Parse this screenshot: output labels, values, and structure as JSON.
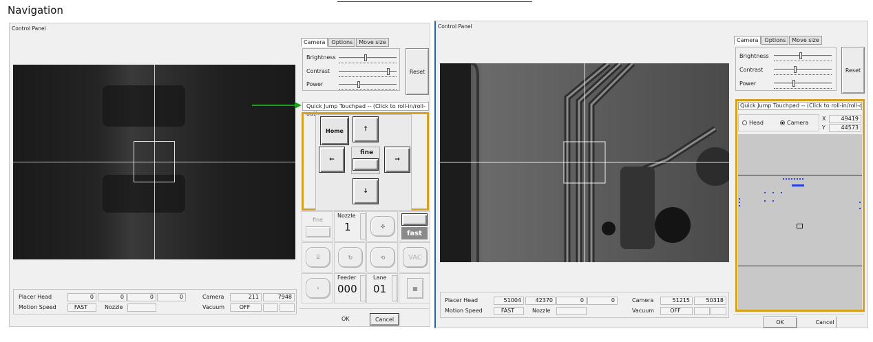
{
  "page_title": "Navigation",
  "left_panel": {
    "window_title": "Control Panel",
    "tabs": [
      "Camera",
      "Options",
      "Move size"
    ],
    "sliders": [
      {
        "label": "Brightness",
        "value": 0.45
      },
      {
        "label": "Contrast",
        "value": 0.88
      },
      {
        "label": "Power",
        "value": 0.33
      }
    ],
    "reset_label": "Reset",
    "touchpad_header": "Quick Jump Touchpad -- (Click to roll-in/roll-out)",
    "jog": {
      "home": "Home",
      "up": "↑",
      "left": "←",
      "fine": "fine",
      "right": "→",
      "down": "↓"
    },
    "controls": {
      "fine_label": "fine",
      "nozzle_label": "Nozzle",
      "nozzle_value": "1",
      "fast_label": "fast",
      "vac_label": "VAC",
      "feeder_label": "Feeder",
      "feeder_value": "000",
      "lane_label": "Lane",
      "lane_value": "01"
    },
    "info": {
      "placer_head_label": "Placer Head",
      "placer_head_values": [
        "0",
        "0",
        "0",
        "0"
      ],
      "camera_label": "Camera",
      "camera_values": [
        "211",
        "7948"
      ],
      "motion_speed_label": "Motion Speed",
      "motion_speed_value": "FAST",
      "nozzle_label": "Nozzle",
      "vacuum_label": "Vacuum",
      "vacuum_value": "OFF"
    },
    "ok_label": "OK",
    "cancel_label": "Cancel"
  },
  "right_panel": {
    "window_title": "Control Panel",
    "tabs": [
      "Camera",
      "Options",
      "Move size"
    ],
    "sliders": [
      {
        "label": "Brightness",
        "value": 0.45
      },
      {
        "label": "Contrast",
        "value": 0.35
      },
      {
        "label": "Power",
        "value": 0.33
      }
    ],
    "reset_label": "Reset",
    "touchpad_header": "Quick Jump Touchpad -- (Click to roll-in/roll-out)",
    "radio_head_label": "Head",
    "radio_camera_label": "Camera",
    "selected_radio": "Camera",
    "x_label": "X",
    "x_value": "49419",
    "y_label": "Y",
    "y_value": "44573",
    "info": {
      "placer_head_label": "Placer Head",
      "placer_head_values": [
        "51004",
        "42370",
        "0",
        "0"
      ],
      "camera_label": "Camera",
      "camera_values": [
        "51215",
        "50318"
      ],
      "motion_speed_label": "Motion Speed",
      "motion_speed_value": "FAST",
      "nozzle_label": "Nozzle",
      "vacuum_label": "Vacuum",
      "vacuum_value": "OFF"
    },
    "ok_label": "OK",
    "cancel_label": "Cancel"
  },
  "colors": {
    "highlight": "#d6a21e",
    "arrow": "#1f9e1f",
    "points": "#2a3fe0"
  },
  "icons": [
    "green-arrow-icon",
    "nozzle-icon",
    "rotate-icon",
    "pickup-icon",
    "place-icon",
    "grid-icon"
  ]
}
